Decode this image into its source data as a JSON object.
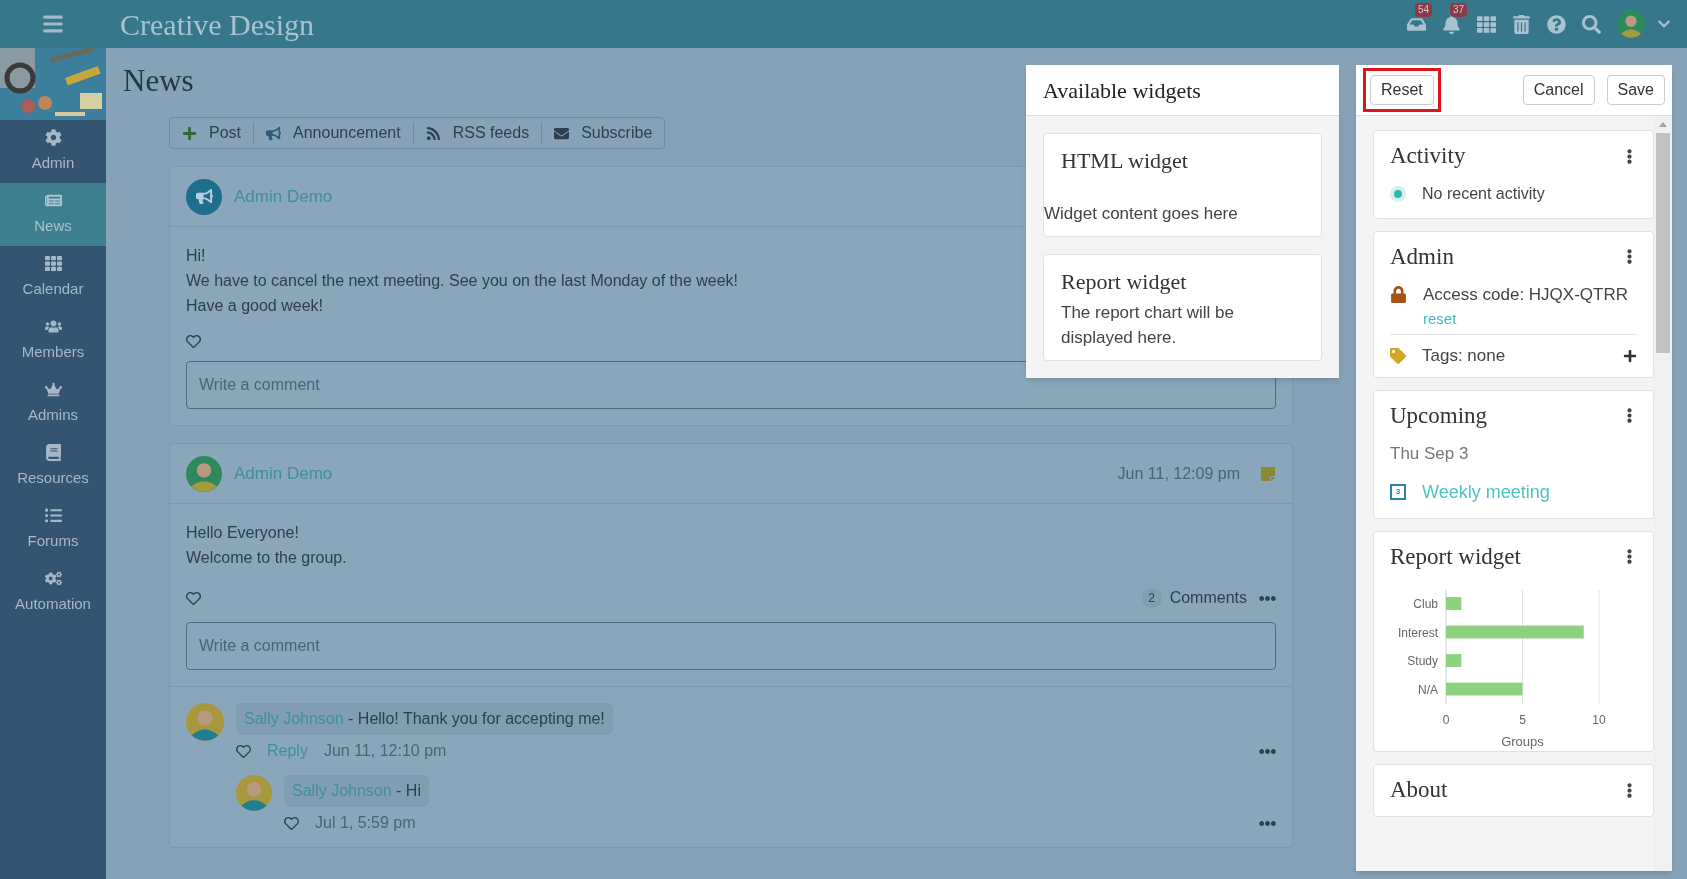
{
  "app": {
    "title": "Creative Design",
    "mail_count": "54",
    "alert_count": "37"
  },
  "sidebar": {
    "items": [
      {
        "label": "Admin",
        "selected": false
      },
      {
        "label": "News",
        "selected": true
      },
      {
        "label": "Calendar",
        "selected": false
      },
      {
        "label": "Members",
        "selected": false
      },
      {
        "label": "Admins",
        "selected": false
      },
      {
        "label": "Resources",
        "selected": false
      },
      {
        "label": "Forums",
        "selected": false
      },
      {
        "label": "Automation",
        "selected": false
      }
    ]
  },
  "page_title": "News",
  "toolbar": [
    "Post",
    "Announcement",
    "RSS feeds",
    "Subscribe"
  ],
  "posts": [
    {
      "kind": "announcement",
      "author": "Admin Demo",
      "body": [
        "Hi!",
        "We have to cancel the next meeting. See you on the last Monday of the week!",
        "Have a good week!"
      ],
      "comment_placeholder": "Write a comment"
    },
    {
      "kind": "user",
      "author": "Admin Demo",
      "time": "Jun 11, 12:09 pm",
      "body": [
        "Hello Everyone!",
        "Welcome to the group."
      ],
      "comment_count": "2",
      "comments_label": "Comments",
      "comment_placeholder": "Write a comment",
      "comments": [
        {
          "author": "Sally Johnson",
          "text": "- Hello! Thank you for accepting me!",
          "reply": "Reply",
          "time": "Jun 11, 12:10 pm",
          "children": [
            {
              "author": "Sally Johnson",
              "text": "- Hi",
              "time": "Jul 1, 5:59 pm"
            }
          ]
        }
      ]
    }
  ],
  "widgets_panel": {
    "title": "Available widgets",
    "items": [
      {
        "title": "HTML widget",
        "text": "Widget content goes here",
        "kind": "html"
      },
      {
        "title": "Report widget",
        "text": "The report chart will be displayed here.",
        "kind": "report"
      }
    ]
  },
  "layout_panel": {
    "buttons": [
      {
        "label": "Reset",
        "highlighted": true
      },
      {
        "label": "Cancel",
        "highlighted": false
      },
      {
        "label": "Save",
        "highlighted": false
      }
    ],
    "activity": {
      "title": "Activity",
      "text": "No recent activity"
    },
    "admin": {
      "title": "Admin",
      "access_code": "Access code: HJQX-QTRR",
      "reset": "reset",
      "tags": "Tags: none"
    },
    "upcoming": {
      "title": "Upcoming",
      "date": "Thu Sep 3",
      "event": "Weekly meeting",
      "day": "3"
    },
    "report": {
      "title": "Report widget",
      "chart_data": {
        "type": "bar",
        "orientation": "horizontal",
        "xlabel": "Groups",
        "categories": [
          "Club",
          "Interest",
          "Study",
          "N/A"
        ],
        "series": [
          {
            "color": "#8cd17d",
            "values": [
              1,
              9,
              1,
              5
            ]
          }
        ],
        "xlim": [
          0,
          10
        ],
        "xticks": [
          0,
          5,
          10
        ]
      }
    },
    "about": {
      "title": "About"
    }
  }
}
